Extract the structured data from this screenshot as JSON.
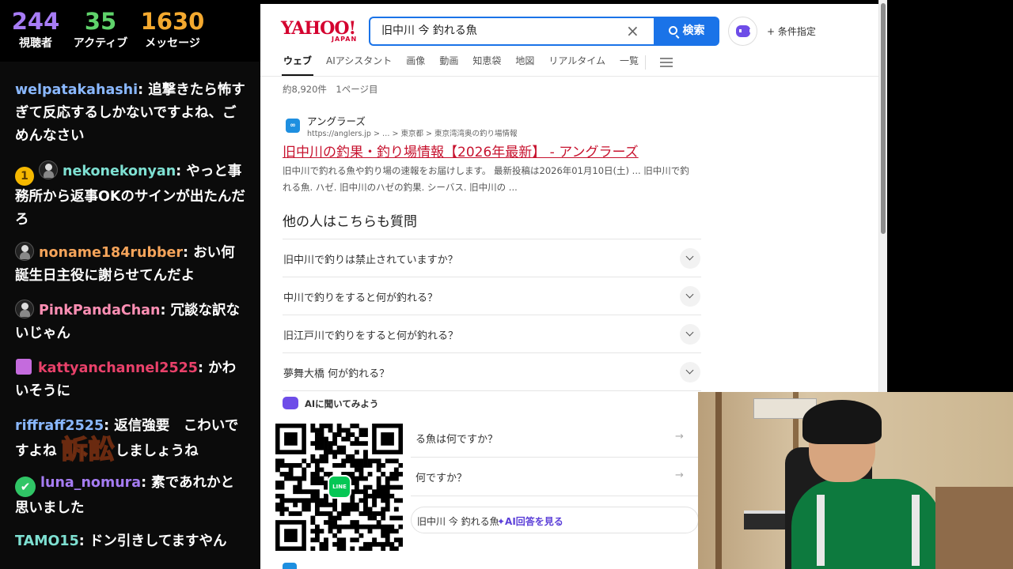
{
  "stats": [
    {
      "value": "244",
      "label": "視聴者",
      "color": "#a77cf5"
    },
    {
      "value": "35",
      "label": "アクティブ",
      "color": "#5fd36b"
    },
    {
      "value": "1630",
      "label": "メッセージ",
      "color": "#f4a92f"
    }
  ],
  "chat": [
    {
      "user": "welpatakahashi",
      "user_color": "#8ab8ff",
      "text": ": 追撃きたら怖すぎて反応するしかないですよね、ごめんなさい",
      "badge": ""
    },
    {
      "user": "nekonekonyan",
      "user_color": "#7ee0d2",
      "text": ": やっと事務所から返事OKのサインが出たんだろ",
      "badge": "1"
    },
    {
      "user": "noname184rubber",
      "user_color": "#f5a45a",
      "text": ": おい何誕生日主役に謝らせてんだよ",
      "badge": ""
    },
    {
      "user": "PinkPandaChan",
      "user_color": "#ff8fb4",
      "text": ": 冗談な訳ないじゃん",
      "badge": ""
    },
    {
      "user": "kattyanchannel2525",
      "user_color": "#e8416a",
      "text": ": かわいそうに",
      "badge": ""
    },
    {
      "user": "riffraff2525",
      "user_color": "#8ab8ff",
      "text_before": ": 返信強要　こわいですよね ",
      "sticker": "訴訟",
      "text_after": "しましょうね",
      "badge": ""
    },
    {
      "user": "luna_nomura",
      "user_color": "#a57cf2",
      "text": ": 素であれかと思いました",
      "badge": ""
    },
    {
      "user": "TAMO15",
      "user_color": "#7ee0d2",
      "text": ": ドン引きしてますやん",
      "badge": ""
    }
  ],
  "yahoo": {
    "logo": "YAHOO!",
    "logo_sub": "JAPAN",
    "search_query": "旧中川 今 釣れる魚",
    "clear_glyph": "×",
    "search_button": "検索",
    "conditions": "+ 条件指定",
    "tabs": [
      "ウェブ",
      "AIアシスタント",
      "画像",
      "動画",
      "知恵袋",
      "地図",
      "リアルタイム",
      "一覧"
    ],
    "result_count": "約8,920件　1ページ目",
    "result": {
      "favicon": "∞",
      "site": "アングラーズ",
      "url": "https://anglers.jp > … > 東京都 > 東京湾湾奥の釣り場情報",
      "title": "旧中川の釣果・釣り場情報【2026年最新】 - アングラーズ",
      "snippet": "旧中川で釣れる魚や釣り場の速報をお届けします。 最新投稿は2026年01月10日(土) ... 旧中川で釣れる魚. ハゼ. 旧中川のハゼの釣果. シーバス. 旧中川の ..."
    },
    "paa_heading": "他の人はこちらも質問",
    "paa": [
      "旧中川で釣りは禁止されていますか？",
      "中川で釣りをすると何が釣れる？",
      "旧江戸川で釣りをすると何が釣れる？",
      "夢舞大橋 何が釣れる？"
    ],
    "ai_ask": "AIに聞いてみよう",
    "suggestions": [
      "る魚は何ですか？",
      "何ですか？"
    ],
    "ai_answer_query": "旧中川 今 釣れる魚",
    "ai_answer_link": "✦AI回答を見る"
  },
  "qr": {
    "logo_text": "LINE"
  }
}
